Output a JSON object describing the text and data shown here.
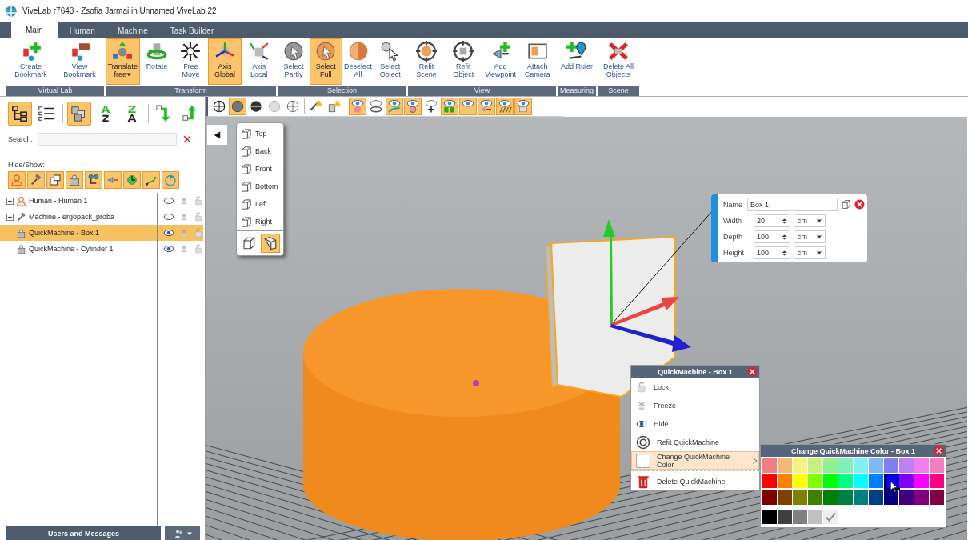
{
  "window": {
    "title": "ViveLab r7643 - Zsofia Jarmai in Unnamed ViveLab 22"
  },
  "tabs": [
    {
      "label": "Main",
      "selected": true
    },
    {
      "label": "Human",
      "selected": false
    },
    {
      "label": "Machine",
      "selected": false
    },
    {
      "label": "Task Builder",
      "selected": false
    }
  ],
  "ribbon": {
    "groups": [
      {
        "label": "Virtual Lab",
        "buttons": [
          {
            "label": "Create Bookmark",
            "selected": false,
            "dropdown": false
          },
          {
            "label": "View Bookmark",
            "selected": false,
            "dropdown": false
          }
        ]
      },
      {
        "label": "Transform",
        "buttons": [
          {
            "label": "Translate free",
            "selected": true,
            "dropdown": true
          },
          {
            "label": "Rotate",
            "selected": false,
            "dropdown": false
          },
          {
            "label": "Free Move",
            "selected": false,
            "dropdown": false
          },
          {
            "label": "Axis Global",
            "selected": true,
            "dropdown": false
          },
          {
            "label": "Axis Local",
            "selected": false,
            "dropdown": false
          }
        ]
      },
      {
        "label": "Selection",
        "buttons": [
          {
            "label": "Select Partly",
            "selected": false,
            "dropdown": false
          },
          {
            "label": "Select Full",
            "selected": true,
            "dropdown": false
          },
          {
            "label": "Deselect All",
            "selected": false,
            "dropdown": false
          },
          {
            "label": "Select Object",
            "selected": false,
            "dropdown": false
          }
        ]
      },
      {
        "label": "View",
        "buttons": [
          {
            "label": "Refit Scene",
            "selected": false,
            "dropdown": false
          },
          {
            "label": "Refit Object",
            "selected": false,
            "dropdown": false
          },
          {
            "label": "Add Viewpoint",
            "selected": false,
            "dropdown": false
          },
          {
            "label": "Attach Camera",
            "selected": false,
            "dropdown": false
          }
        ]
      },
      {
        "label": "Measuring",
        "buttons": [
          {
            "label": "Add Ruler",
            "selected": false,
            "dropdown": false
          }
        ]
      },
      {
        "label": "Scene",
        "buttons": [
          {
            "label": "Delete All Objects",
            "selected": false,
            "dropdown": false
          }
        ]
      }
    ]
  },
  "tree_panel": {
    "toolbar": [
      {
        "selected": true
      },
      {
        "selected": false
      },
      {
        "selected": true
      },
      {
        "selected": false
      },
      {
        "selected": false
      },
      {
        "selected": false
      },
      {
        "selected": false
      }
    ],
    "search": {
      "label": "Search:"
    },
    "hide_show": {
      "label": "Hide/Show:",
      "filters": [
        {
          "selected": true
        },
        {
          "selected": true
        },
        {
          "selected": true
        },
        {
          "selected": true
        },
        {
          "selected": true
        },
        {
          "selected": true
        },
        {
          "selected": true
        },
        {
          "selected": true
        },
        {
          "selected": true
        }
      ]
    },
    "items": [
      {
        "kind": "group",
        "label": "Human - Human 1",
        "expanded": false,
        "selected": false,
        "visible": false
      },
      {
        "kind": "group",
        "label": "Machine - ergopack_proba",
        "expanded": false,
        "selected": false,
        "visible": false
      },
      {
        "kind": "leaf",
        "label": "QuickMachine - Box 1",
        "selected": true,
        "visible": true
      },
      {
        "kind": "leaf",
        "label": "QuickMachine - Cylinder 1",
        "selected": false,
        "visible": true
      }
    ]
  },
  "bottom_bar": {
    "label": "Users and Messages"
  },
  "viewport": {
    "toolbar": [
      {
        "selected": false
      },
      {
        "selected": true
      },
      {
        "selected": false
      },
      {
        "selected": false
      },
      {
        "selected": false
      },
      {
        "selected": false
      },
      {
        "selected": false
      },
      {
        "selected": true
      },
      {
        "selected": false
      },
      {
        "selected": true
      },
      {
        "selected": true
      },
      {
        "selected": false
      },
      {
        "selected": true
      },
      {
        "selected": true
      },
      {
        "selected": true
      },
      {
        "selected": true
      },
      {
        "selected": true
      }
    ],
    "view_menu": {
      "items": [
        {
          "label": "Top"
        },
        {
          "label": "Back"
        },
        {
          "label": "Front"
        },
        {
          "label": "Bottom"
        },
        {
          "label": "Left"
        },
        {
          "label": "Right"
        }
      ],
      "projections": [
        {
          "selected": false
        },
        {
          "selected": true
        }
      ]
    },
    "properties": {
      "name_label": "Name",
      "name": "Box 1",
      "fields": [
        {
          "label": "Width",
          "value": "20",
          "unit": "cm"
        },
        {
          "label": "Depth",
          "value": "100",
          "unit": "cm"
        },
        {
          "label": "Height",
          "value": "100",
          "unit": "cm"
        }
      ]
    },
    "context_menu": {
      "title": "QuickMachine - Box 1",
      "items": [
        {
          "label": "Lock",
          "selected": false,
          "submenu": false
        },
        {
          "label": "Freeze",
          "selected": false,
          "submenu": false
        },
        {
          "label": "Hide",
          "selected": false,
          "submenu": false
        },
        {
          "label": "Refit QuickMachine",
          "selected": false,
          "submenu": false
        },
        {
          "label": "Change QuickMachine Color",
          "selected": true,
          "submenu": true
        },
        {
          "label": "Delete QuickMachine",
          "selected": false,
          "submenu": false
        }
      ]
    },
    "color_picker": {
      "title": "Change QuickMachine Color - Box 1",
      "swatches": [
        {
          "color": "#f08080",
          "selected": false
        },
        {
          "color": "#f5b878",
          "selected": false
        },
        {
          "color": "#f5f080",
          "selected": false
        },
        {
          "color": "#c8f080",
          "selected": false
        },
        {
          "color": "#90f090",
          "selected": false
        },
        {
          "color": "#80f0b8",
          "selected": false
        },
        {
          "color": "#80f0f0",
          "selected": false
        },
        {
          "color": "#80b8f5",
          "selected": false
        },
        {
          "color": "#8080f5",
          "selected": false
        },
        {
          "color": "#c080f5",
          "selected": false
        },
        {
          "color": "#f080f0",
          "selected": false
        },
        {
          "color": "#f080c0",
          "selected": false
        },
        {
          "color": "#ff0000",
          "selected": false
        },
        {
          "color": "#ff8000",
          "selected": false
        },
        {
          "color": "#ffff00",
          "selected": false
        },
        {
          "color": "#80ff00",
          "selected": false
        },
        {
          "color": "#00ff00",
          "selected": false
        },
        {
          "color": "#00ff80",
          "selected": false
        },
        {
          "color": "#00ffff",
          "selected": false
        },
        {
          "color": "#0080ff",
          "selected": false
        },
        {
          "color": "#0000ff",
          "selected": true
        },
        {
          "color": "#8000ff",
          "selected": false
        },
        {
          "color": "#ff00ff",
          "selected": false
        },
        {
          "color": "#ff0080",
          "selected": false
        },
        {
          "color": "#800000",
          "selected": false
        },
        {
          "color": "#804000",
          "selected": false
        },
        {
          "color": "#808000",
          "selected": false
        },
        {
          "color": "#408000",
          "selected": false
        },
        {
          "color": "#008000",
          "selected": false
        },
        {
          "color": "#008040",
          "selected": false
        },
        {
          "color": "#008080",
          "selected": false
        },
        {
          "color": "#004080",
          "selected": false
        },
        {
          "color": "#000080",
          "selected": false
        },
        {
          "color": "#400080",
          "selected": false
        },
        {
          "color": "#800080",
          "selected": false
        },
        {
          "color": "#800040",
          "selected": false
        }
      ],
      "grays": [
        {
          "color": "#000000"
        },
        {
          "color": "#404040"
        },
        {
          "color": "#808080"
        },
        {
          "color": "#c0c0c0"
        }
      ]
    }
  }
}
